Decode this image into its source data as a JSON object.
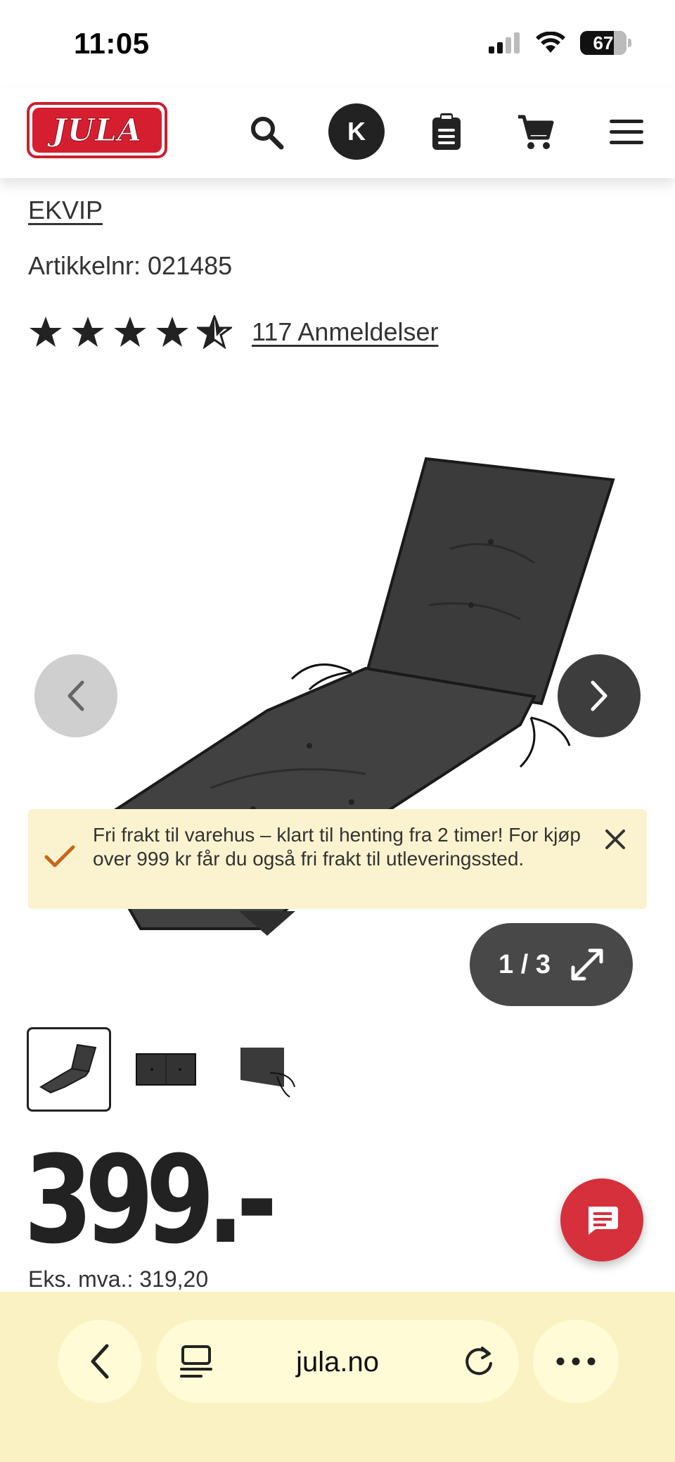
{
  "status_bar": {
    "time": "11:05",
    "battery": "67"
  },
  "header": {
    "logo_text": "JULA",
    "search_icon": "search-icon",
    "account_initial": "K",
    "list_icon": "clipboard-icon",
    "cart_icon": "cart-icon",
    "menu_icon": "hamburger-menu-icon"
  },
  "product": {
    "brand": "EKVIP",
    "article_number": "Artikkelnr: 021485",
    "rating_stars": 4.5,
    "reviews_label": "117 Anmeldelser",
    "price": "399.-",
    "price_excl_vat": "Eks. mva.: 319,20"
  },
  "gallery": {
    "counter": "1 / 3",
    "thumbnails": [
      "thumbnail-lounger-cushion",
      "thumbnail-cushion-flat",
      "thumbnail-cushion-detail"
    ]
  },
  "notice": {
    "text": "Fri frakt til varehus – klart til henting fra 2 timer! For kjøp over 999 kr får du også fri frakt til utleveringssted."
  },
  "browser": {
    "url": "jula.no"
  },
  "colors": {
    "brand_red": "#d51f31",
    "notice_bg": "#fbf3cf",
    "browser_bg": "#faf2c2",
    "check_orange": "#c4671a"
  }
}
